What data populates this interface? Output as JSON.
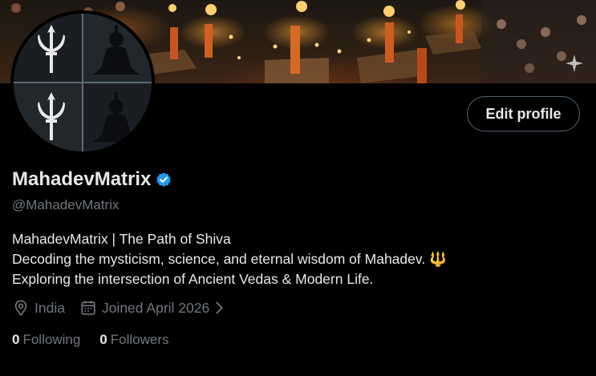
{
  "profile": {
    "display_name": "MahadevMatrix",
    "handle": "@MahadevMatrix",
    "verified": true,
    "edit_button_label": "Edit profile",
    "bio": {
      "line1": "MahadevMatrix | The Path of Shiva",
      "line2": "Decoding the mysticism, science, and eternal wisdom of Mahadev.",
      "line2_emoji": "🔱",
      "line3": "Exploring the intersection of Ancient Vedas & Modern Life."
    },
    "location": "India",
    "joined": "Joined April 2026",
    "following_count": "0",
    "following_label": "Following",
    "followers_count": "0",
    "followers_label": "Followers"
  },
  "icons": {
    "location": "location-pin-icon",
    "calendar": "calendar-icon",
    "chevron": "chevron-right-icon",
    "verified": "verified-badge-icon",
    "sparkle": "sparkle-icon"
  },
  "colors": {
    "background": "#000000",
    "text_primary": "#e7e9ea",
    "text_secondary": "#71767b",
    "border": "#536471",
    "verified_blue": "#1d9bf0",
    "trident_gold": "#f5c84c"
  }
}
